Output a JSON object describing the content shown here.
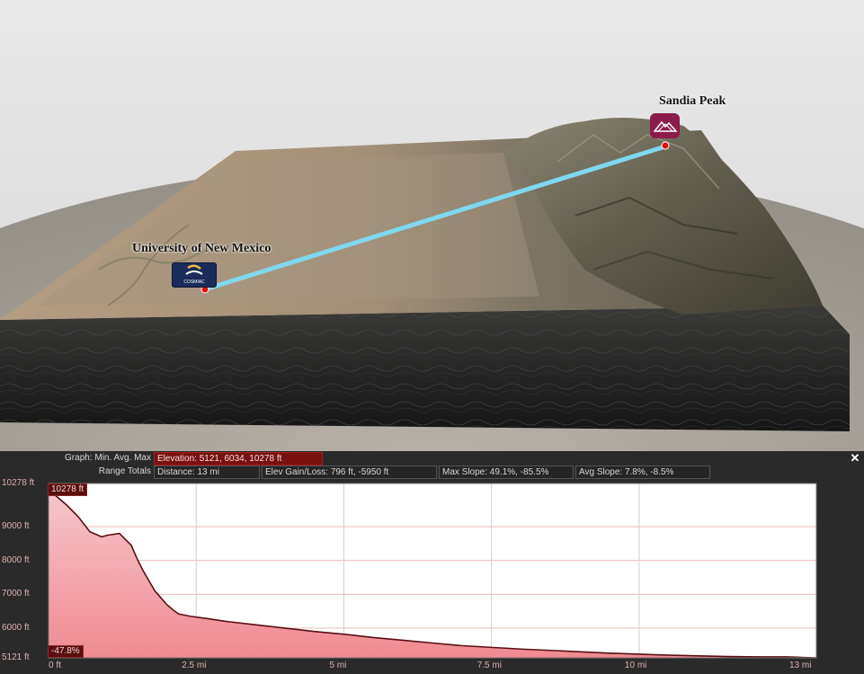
{
  "scene": {
    "markers": [
      {
        "label": "University of New Mexico",
        "icon": "cosmiac-logo-icon",
        "badge_text": "COSMIAC"
      },
      {
        "label": "Sandia Peak",
        "icon": "mountain-icon"
      }
    ],
    "colors": {
      "route": "#7fd8ee",
      "marker_pin": "#e01010",
      "unm_badge": "#1b2b5a",
      "sandia_badge": "#8c1c4b"
    }
  },
  "panel": {
    "graph_label": "Graph: Min. Avg. Max",
    "elevation_stat": "Elevation: 5121, 6034, 10278 ft",
    "range_label": "Range Totals",
    "distance_stat": "Distance: 13 mi",
    "elev_gain_stat": "Elev Gain/Loss: 796 ft, -5950 ft",
    "max_slope_stat": "Max Slope: 49.1%, -85.5%",
    "avg_slope_stat": "Avg Slope: 7.8%, -8.5%",
    "close_label": "✕",
    "max_tag": "10278 ft",
    "slope_tag": "-47.8%"
  },
  "chart_data": {
    "type": "area",
    "xlim": [
      0,
      13
    ],
    "ylim": [
      5121,
      10278
    ],
    "x_ticks": [
      "0 ft",
      "2.5 mi",
      "5 mi",
      "7.5 mi",
      "10 mi",
      "13 mi"
    ],
    "x_tick_values": [
      0,
      2.5,
      5,
      7.5,
      10,
      13
    ],
    "y_ticks": [
      "10278 ft",
      "9000 ft",
      "8000 ft",
      "7000 ft",
      "6000 ft",
      "5121 ft"
    ],
    "y_tick_values": [
      10278,
      9000,
      8000,
      7000,
      6000,
      5121
    ],
    "series": [
      {
        "x": [
          0,
          0.1,
          0.3,
          0.5,
          0.7,
          0.9,
          1.0,
          1.2,
          1.4,
          1.5,
          1.6,
          1.7,
          1.8,
          1.9,
          2.0,
          2.1,
          2.2,
          2.4,
          2.7,
          3.0,
          3.5,
          4.0,
          4.5,
          5.0,
          5.5,
          6.0,
          6.5,
          7.0,
          7.5,
          8.0,
          8.5,
          9.0,
          9.5,
          10.0,
          10.5,
          11.0,
          11.5,
          12.0,
          12.5,
          12.8,
          13.0
        ],
        "y": [
          10278,
          9950,
          9650,
          9300,
          8850,
          8700,
          8750,
          8800,
          8450,
          8050,
          7700,
          7400,
          7100,
          6900,
          6700,
          6550,
          6420,
          6350,
          6280,
          6200,
          6100,
          6000,
          5900,
          5820,
          5720,
          5640,
          5560,
          5480,
          5430,
          5380,
          5340,
          5300,
          5260,
          5230,
          5200,
          5180,
          5160,
          5150,
          5150,
          5130,
          5121
        ]
      }
    ]
  }
}
